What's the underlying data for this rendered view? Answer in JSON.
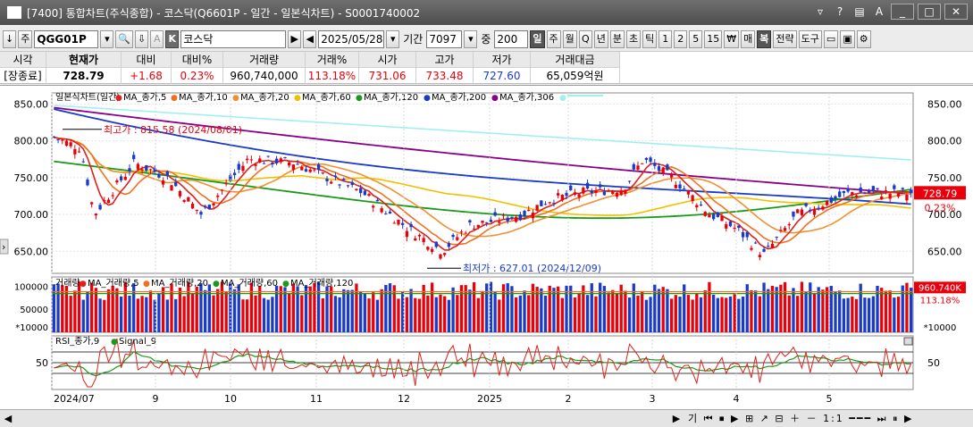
{
  "window": {
    "title": "[7400]  통합차트(주식종합) - 코스닥(Q6601P - 일간 - 일본식차트) - S0001740002",
    "controls": [
      "?",
      "▤",
      "A",
      "_",
      "□",
      "✕"
    ]
  },
  "toolbar": {
    "btn_arrow": "↓",
    "btn_type": "주",
    "code": "QGG01P",
    "btn_search": "🔍",
    "btn_list": "⇩",
    "btn_a": "A",
    "btn_k": "K",
    "name": "코스닥",
    "btn_play": "▶",
    "btn_prev": "◀",
    "date": "2025/05/28",
    "period_label": "기간",
    "period_value": "7097",
    "count_label": "중",
    "count_value": "200",
    "intervals": [
      "일",
      "주",
      "월",
      "Q",
      "년",
      "분",
      "초",
      "틱",
      "1",
      "2",
      "5",
      "15"
    ],
    "btn_won": "₩",
    "btn_mae": "매",
    "btn_bok": "복",
    "strategy": "전략",
    "tools": "도구"
  },
  "quote": {
    "headers": [
      "시각",
      "현재가",
      "대비",
      "대비%",
      "거래량",
      "거래%",
      "시가",
      "고가",
      "저가",
      "거래대금"
    ],
    "values": [
      "[장종료]",
      "728.79",
      "+1.68",
      "0.23%",
      "960,740,000",
      "113.18%",
      "731.06",
      "733.48",
      "727.60",
      "65,059억원"
    ]
  },
  "chart": {
    "legend_main": [
      {
        "text": "일본식차트(일간)",
        "color": "#000000"
      },
      {
        "text": "MA_종가,5",
        "color": "#e0201a"
      },
      {
        "text": "MA_종가,10",
        "color": "#f07020"
      },
      {
        "text": "MA_종가,20",
        "color": "#f09030"
      },
      {
        "text": "MA_종가,60",
        "color": "#f0c000"
      },
      {
        "text": "MA_종가,120",
        "color": "#1a9a1a"
      },
      {
        "text": "MA_종가,200",
        "color": "#1a3ac8"
      },
      {
        "text": "MA_종가,306",
        "color": "#880088"
      },
      {
        "text": "",
        "color": "#a0f0f0"
      }
    ],
    "price_ticks": [
      "850.00",
      "800.00",
      "750.00",
      "700.00",
      "650.00"
    ],
    "high_label": "최고가 : 815.58 (2024/08/01)",
    "low_label": "최저가 : 627.01 (2024/12/09)",
    "current_price": "728.79",
    "current_pct": "0.23%",
    "legend_volume": [
      {
        "text": "거래량",
        "color": "#000000"
      },
      {
        "text": "MA_거래량,5",
        "color": "#e0201a"
      },
      {
        "text": "MA_거래량,20",
        "color": "#f07020"
      },
      {
        "text": "MA_거래량,60",
        "color": "#1a9a1a"
      },
      {
        "text": "MA_거래량,120",
        "color": "#1a9a1a"
      }
    ],
    "vol_ticks": [
      "100000",
      "50000"
    ],
    "vol_unit": "*10000",
    "vol_current": "960.740K",
    "vol_pct": "113.18%",
    "legend_rsi": [
      {
        "text": "RSI_종가,9",
        "color": "#e0201a"
      },
      {
        "text": "Signal_9",
        "color": "#1a9a1a"
      }
    ],
    "rsi_tick": "50",
    "x_labels": [
      "2024/07",
      "9",
      "10",
      "11",
      "12",
      "2025",
      "2",
      "3",
      "4",
      "5"
    ]
  },
  "chart_data": {
    "type": "candlestick",
    "period": "daily",
    "price_range": [
      620,
      865
    ],
    "close_anchors": [
      {
        "x": "2024/07",
        "close": 805
      },
      {
        "x": "2024/08/01",
        "high": 815.58
      },
      {
        "x": "2024/08/05",
        "close": 700
      },
      {
        "x": "2024/08",
        "close": 765
      },
      {
        "x": "2024/09",
        "close": 710
      },
      {
        "x": "2024/10",
        "close": 770
      },
      {
        "x": "2024/11",
        "close": 745
      },
      {
        "x": "2024/11/15",
        "close": 680
      },
      {
        "x": "2024/12/09",
        "low": 627.01
      },
      {
        "x": "2024/12",
        "close": 690
      },
      {
        "x": "2025/01",
        "close": 720
      },
      {
        "x": "2025/02",
        "close": 730
      },
      {
        "x": "2025/02/20",
        "close": 775
      },
      {
        "x": "2025/03",
        "close": 735
      },
      {
        "x": "2025/04/09",
        "close": 645
      },
      {
        "x": "2025/04",
        "close": 700
      },
      {
        "x": "2025/05",
        "close": 730
      },
      {
        "x": "2025/05/28",
        "close": 728.79
      }
    ],
    "ma_series": [
      {
        "name": "MA_종가,120",
        "start": 772,
        "end": 720
      },
      {
        "name": "MA_종가,200",
        "start": 843,
        "end": 714
      },
      {
        "name": "MA_종가,306",
        "start": 845,
        "end": 728
      },
      {
        "name": "",
        "start": 848,
        "end": 774
      }
    ],
    "volume_range": [
      0,
      120000
    ],
    "rsi_range": [
      0,
      100
    ]
  }
}
